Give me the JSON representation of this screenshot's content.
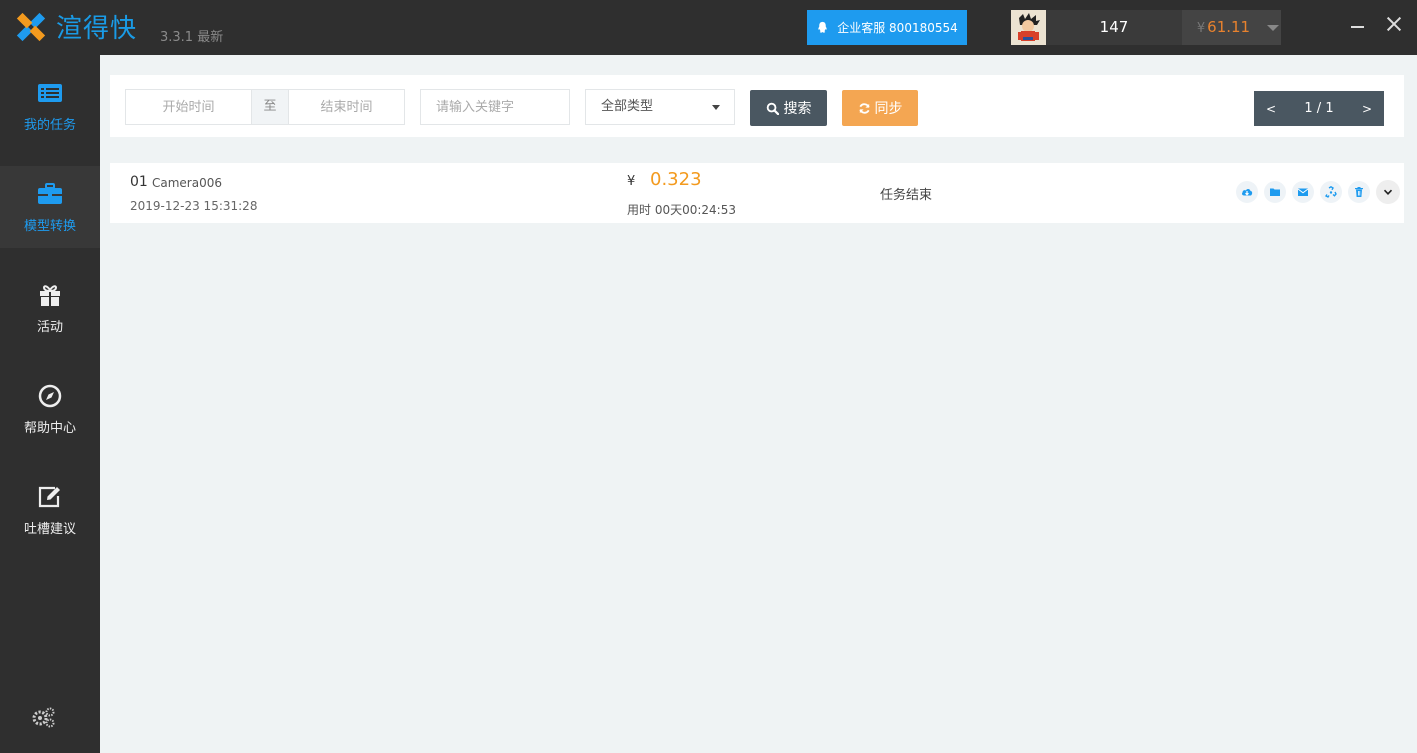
{
  "app": {
    "name": "渲得快",
    "version": "3.3.1 最新",
    "brand_color": "#1a9be6"
  },
  "header": {
    "service_label": "企业客服 800180554",
    "user_count": "147",
    "balance_currency": "¥",
    "balance_value": "61.11"
  },
  "sidebar": {
    "items": [
      {
        "label": "我的任务",
        "icon": "task-list-icon"
      },
      {
        "label": "模型转换",
        "icon": "briefcase-icon"
      },
      {
        "label": "活动",
        "icon": "gift-icon"
      },
      {
        "label": "帮助中心",
        "icon": "compass-icon"
      },
      {
        "label": "吐槽建议",
        "icon": "edit-icon"
      }
    ],
    "settings_icon": "gears-icon"
  },
  "toolbar": {
    "start_placeholder": "开始时间",
    "separator": "至",
    "end_placeholder": "结束时间",
    "keyword_placeholder": "请输入关键字",
    "type_selected": "全部类型",
    "search_label": "搜索",
    "sync_label": "同步"
  },
  "pager": {
    "prev": "<",
    "page": "1 / 1",
    "next": ">"
  },
  "tasks": [
    {
      "index": "01",
      "name": "Camera006",
      "created": "2019-12-23 15:31:28",
      "currency": "¥",
      "cost": "0.323",
      "duration": "用时 00天00:24:53",
      "status": "任务结束"
    }
  ]
}
